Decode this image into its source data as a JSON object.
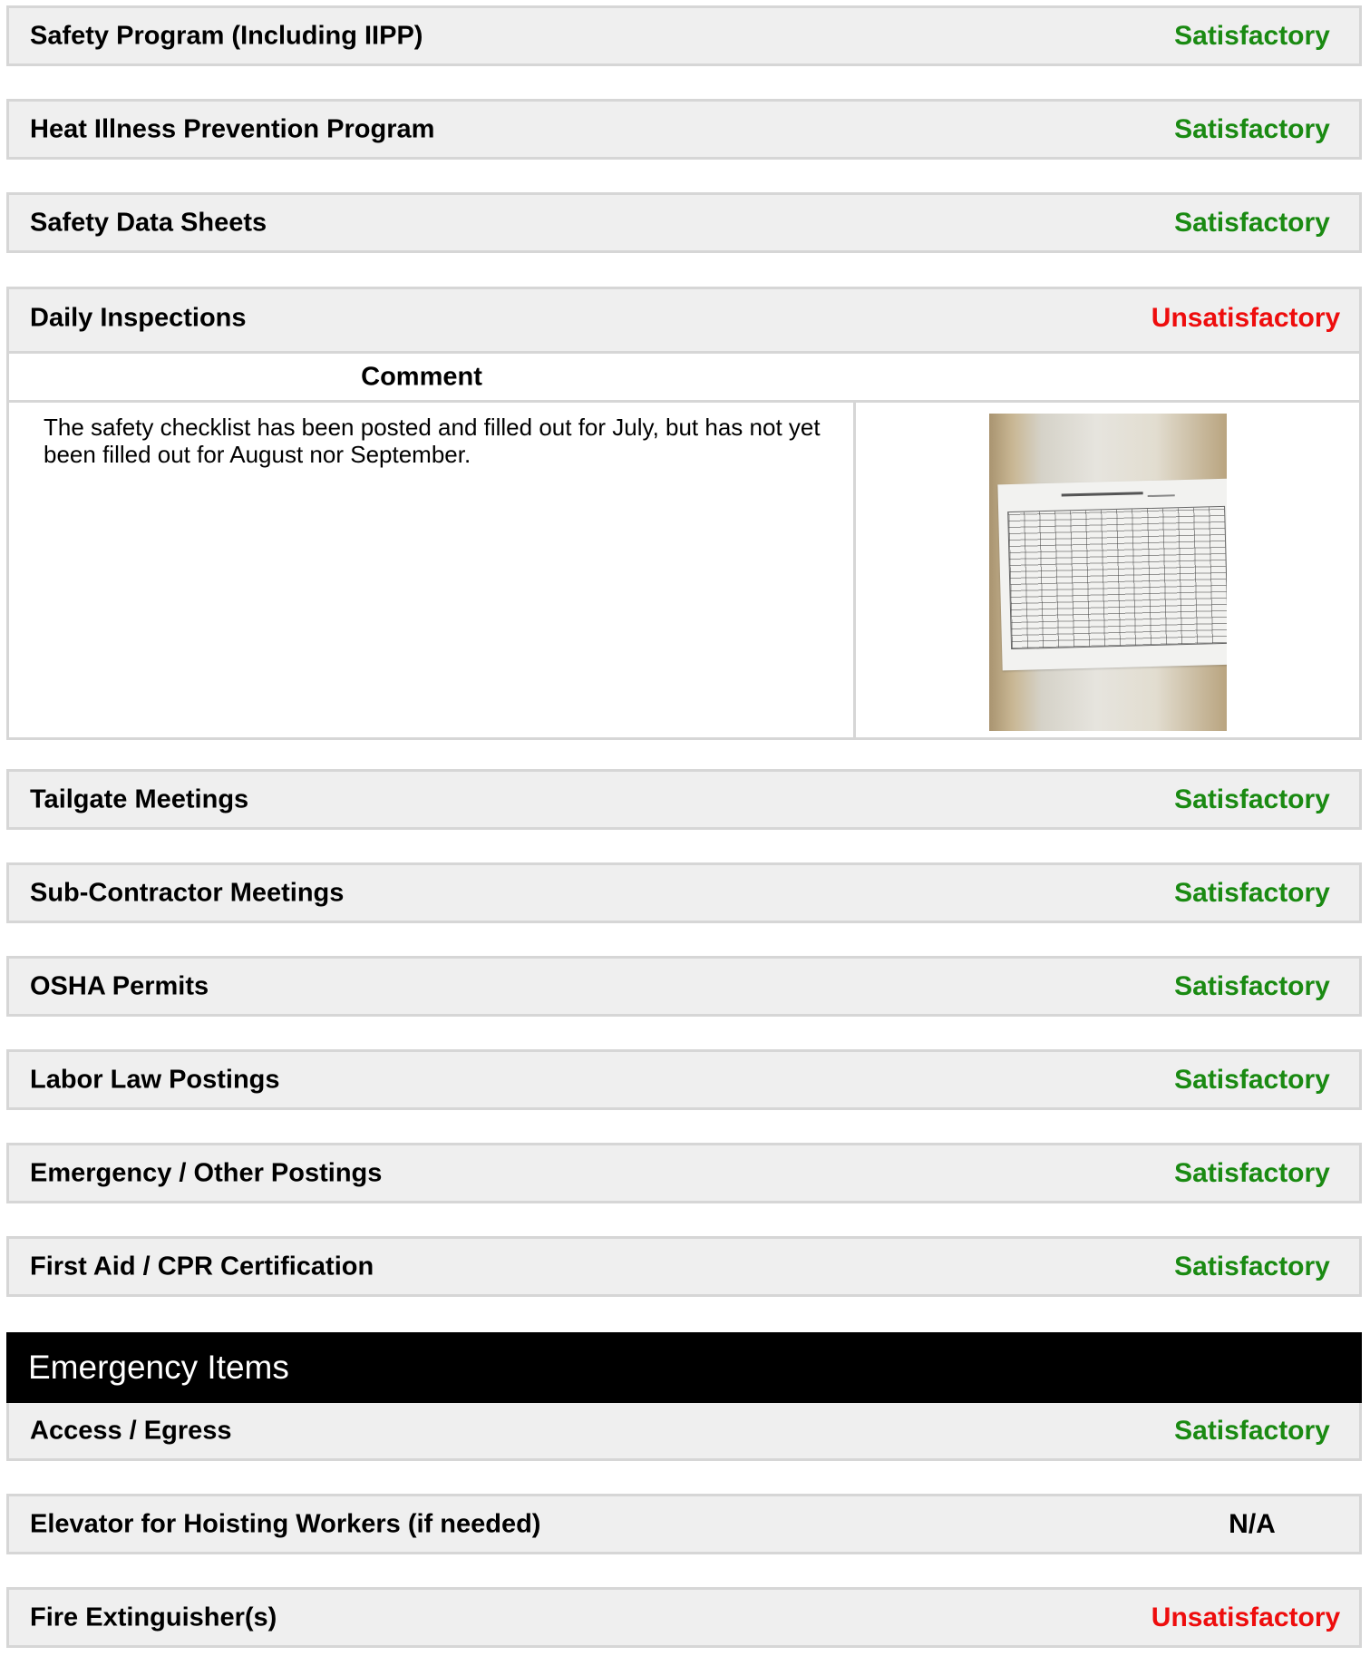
{
  "rows_top": [
    {
      "label": "Safety Program (Including IIPP)",
      "status": "Satisfactory"
    },
    {
      "label": "Heat Illness Prevention Program",
      "status": "Satisfactory"
    },
    {
      "label": "Safety Data Sheets",
      "status": "Satisfactory"
    }
  ],
  "daily": {
    "label": "Daily Inspections",
    "status": "Unsatisfactory",
    "comment_header": "Comment",
    "comment_text": "The safety checklist has been posted and filled out for July, but has not yet been filled out for August nor September."
  },
  "rows_mid": [
    {
      "label": "Tailgate Meetings",
      "status": "Satisfactory"
    },
    {
      "label": "Sub-Contractor Meetings",
      "status": "Satisfactory"
    },
    {
      "label": "OSHA Permits",
      "status": "Satisfactory"
    },
    {
      "label": "Labor Law Postings",
      "status": "Satisfactory"
    },
    {
      "label": "Emergency / Other Postings",
      "status": "Satisfactory"
    },
    {
      "label": "First Aid / CPR Certification",
      "status": "Satisfactory"
    }
  ],
  "emergency": {
    "title": "Emergency Items",
    "rows": [
      {
        "label": "Access / Egress",
        "status": "Satisfactory"
      },
      {
        "label": "Elevator for Hoisting Workers (if needed)",
        "status": "N/A"
      },
      {
        "label": "Fire Extinguisher(s)",
        "status": "Unsatisfactory"
      }
    ]
  },
  "colors": {
    "satisfactory": "#1a8a12",
    "unsatisfactory": "#ee0d0d",
    "na": "#000000",
    "section_header_bg": "#000000"
  }
}
